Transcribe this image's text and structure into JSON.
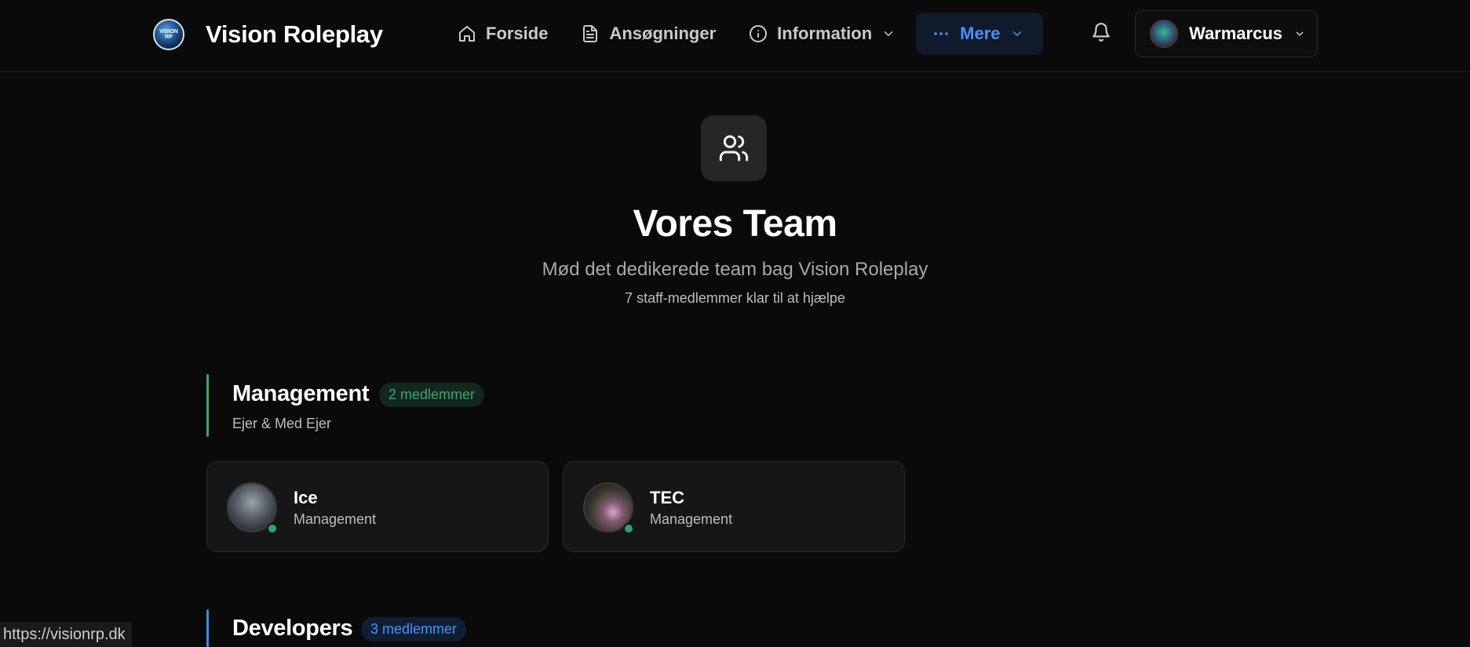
{
  "header": {
    "brand_name": "Vision Roleplay",
    "logo_text": "VISION ROLEPLAY",
    "nav": {
      "forside": "Forside",
      "ansoegninger": "Ansøgninger",
      "information": "Information",
      "mere": "Mere"
    },
    "user_name": "Warmarcus"
  },
  "hero": {
    "title": "Vores Team",
    "subtitle": "Mød det dedikerede team bag Vision Roleplay",
    "count": "7 staff-medlemmer klar til at hjælpe"
  },
  "sections": {
    "management": {
      "title": "Management",
      "badge": "2 medlemmer",
      "description": "Ejer & Med Ejer",
      "accent": "#3fa372",
      "members": [
        {
          "name": "Ice",
          "role": "Management",
          "online": true
        },
        {
          "name": "TEC",
          "role": "Management",
          "online": true
        }
      ]
    },
    "developers": {
      "title": "Developers",
      "badge": "3 medlemmer",
      "accent": "#3b8de0"
    }
  },
  "status_bar": {
    "url": "https://visionrp.dk"
  },
  "colors": {
    "background": "#0a0a0a",
    "card": "#161616",
    "nav_active": "#4f8ff7",
    "online": "#2fa36b"
  }
}
